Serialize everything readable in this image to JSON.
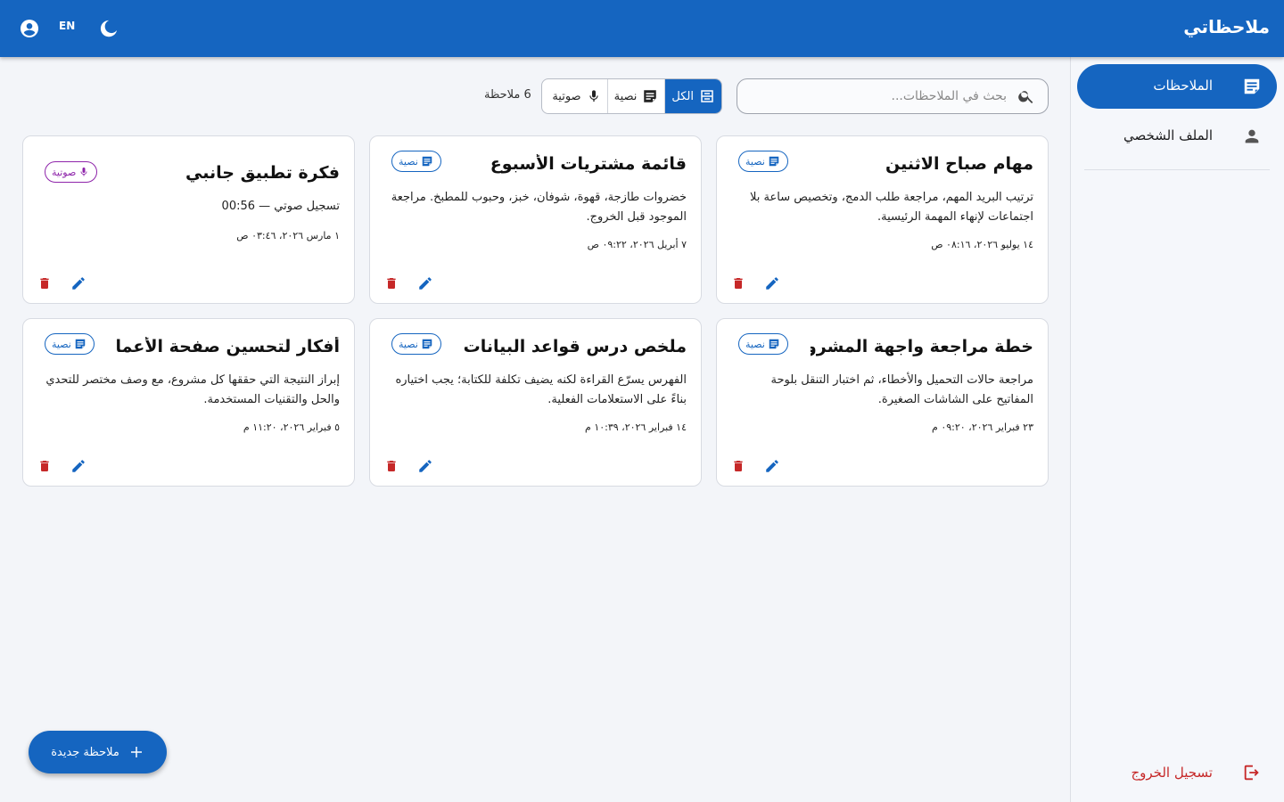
{
  "app": {
    "title": "ملاحظاتي",
    "lang_toggle": "EN"
  },
  "sidebar": {
    "items": [
      {
        "label": "الملاحظات",
        "icon": "note-icon",
        "active": true
      },
      {
        "label": "الملف الشخصي",
        "icon": "person-icon",
        "active": false
      }
    ],
    "logout_label": "تسجيل الخروج"
  },
  "search": {
    "placeholder": "بحث في الملاحظات..."
  },
  "filters": [
    {
      "label": "الكل",
      "icon": "all-icon",
      "active": true
    },
    {
      "label": "نصية",
      "icon": "text-note-icon",
      "active": false
    },
    {
      "label": "صوتية",
      "icon": "mic-icon",
      "active": false
    }
  ],
  "note_count": "6 ملاحظة",
  "notes": [
    {
      "title": "مهام صباح الاثنين",
      "type": "نصية",
      "body": "ترتيب البريد المهم، مراجعة طلب الدمج، وتخصيص ساعة بلا اجتماعات لإنهاء المهمة الرئيسية.",
      "date": "١٤ يوليو ٢٠٢٦، ٠٨:١٦ ص"
    },
    {
      "title": "قائمة مشتريات الأسبوع",
      "type": "نصية",
      "body": "خضروات طازجة، قهوة، شوفان، خبز، وحبوب للمطبخ. مراجعة الموجود قبل الخروج.",
      "date": "٧ أبريل ٢٠٢٦، ٠٩:٢٢ ص"
    },
    {
      "title": "فكرة تطبيق جانبي",
      "type": "صوتية",
      "body": "تسجيل صوتي — 00:56",
      "date": "١ مارس ٢٠٢٦، ٠٣:٤٦ ص"
    },
    {
      "title": "خطة مراجعة واجهة المشروع",
      "type": "نصية",
      "body": "مراجعة حالات التحميل والأخطاء، ثم اختبار التنقل بلوحة المفاتيح على الشاشات الصغيرة.",
      "date": "٢٣ فبراير ٢٠٢٦، ٠٩:٢٠ م"
    },
    {
      "title": "ملخص درس قواعد البيانات",
      "type": "نصية",
      "body": "الفهرس يسرّع القراءة لكنه يضيف تكلفة للكتابة؛ يجب اختياره بناءً على الاستعلامات الفعلية.",
      "date": "١٤ فبراير ٢٠٢٦، ١٠:٣٩ م"
    },
    {
      "title": "أفكار لتحسين صفحة الأعمال",
      "type": "نصية",
      "body": "إبراز النتيجة التي حققها كل مشروع، مع وصف مختصر للتحدي والحل والتقنيات المستخدمة.",
      "date": "٥ فبراير ٢٠٢٦، ١١:٢٠ م"
    }
  ],
  "fab": {
    "label": "ملاحظة جديدة"
  },
  "colors": {
    "primary": "#1565c0",
    "danger": "#c62828",
    "voice": "#8e24aa"
  }
}
